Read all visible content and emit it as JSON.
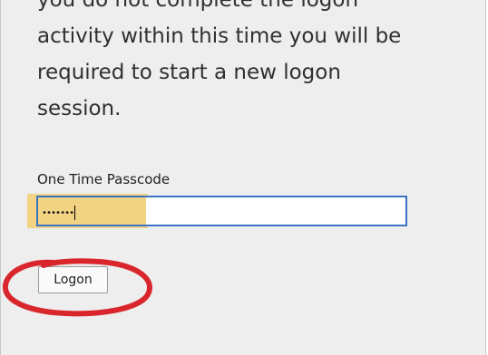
{
  "message": {
    "lines": [
      "you do not complete the logon",
      "activity within this time you will be",
      "required to start a new logon",
      "session."
    ]
  },
  "passcode": {
    "label": "One Time Passcode",
    "masked_value": "•••••••"
  },
  "logon_button": {
    "label": "Logon"
  },
  "annotation": {
    "color": "#d9262c"
  }
}
